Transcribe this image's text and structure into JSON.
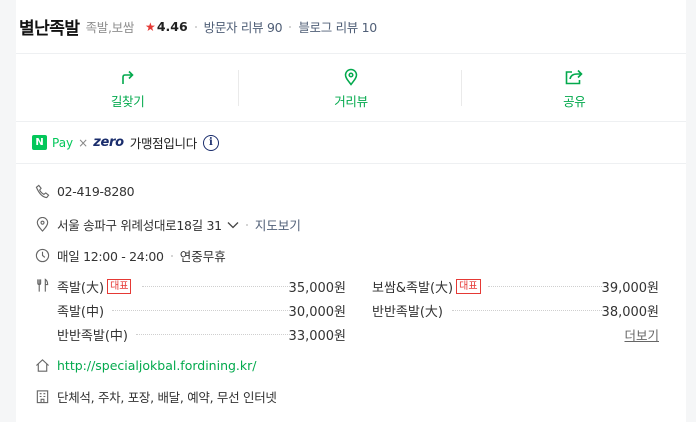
{
  "header": {
    "title": "별난족발",
    "category": "족발,보쌈",
    "rating": "4.46",
    "visitor_reviews": "방문자 리뷰 90",
    "blog_reviews": "블로그 리뷰 10"
  },
  "actions": [
    {
      "label": "길찾기",
      "icon": "directions-icon"
    },
    {
      "label": "거리뷰",
      "icon": "location-pin-icon"
    },
    {
      "label": "공유",
      "icon": "share-icon"
    }
  ],
  "pay": {
    "npay_letter": "N",
    "npay_label": "Pay",
    "x": "×",
    "zero": "zero",
    "text": "가맹점입니다",
    "info": "i"
  },
  "info": {
    "phone": "02-419-8280",
    "address": "서울 송파구 위례성대로18길 31",
    "map_link": "지도보기",
    "hours": "매일 12:00 - 24:00",
    "holiday": "연중무휴",
    "url": "http://specialjokbal.fordining.kr/",
    "facilities": "단체석, 주차, 포장, 배달, 예약, 무선 인터넷"
  },
  "menu": {
    "left": [
      {
        "name": "족발(大)",
        "tag": "대표",
        "price": "35,000원"
      },
      {
        "name": "족발(中)",
        "tag": "",
        "price": "30,000원"
      },
      {
        "name": "반반족발(中)",
        "tag": "",
        "price": "33,000원"
      }
    ],
    "right": [
      {
        "name": "보쌈&족발(大)",
        "tag": "대표",
        "price": "39,000원"
      },
      {
        "name": "반반족발(大)",
        "tag": "",
        "price": "38,000원"
      }
    ],
    "more": "더보기"
  },
  "colors": {
    "accent_green": "#03a94d",
    "star_red": "#e53935",
    "link_navy": "#505f77"
  }
}
